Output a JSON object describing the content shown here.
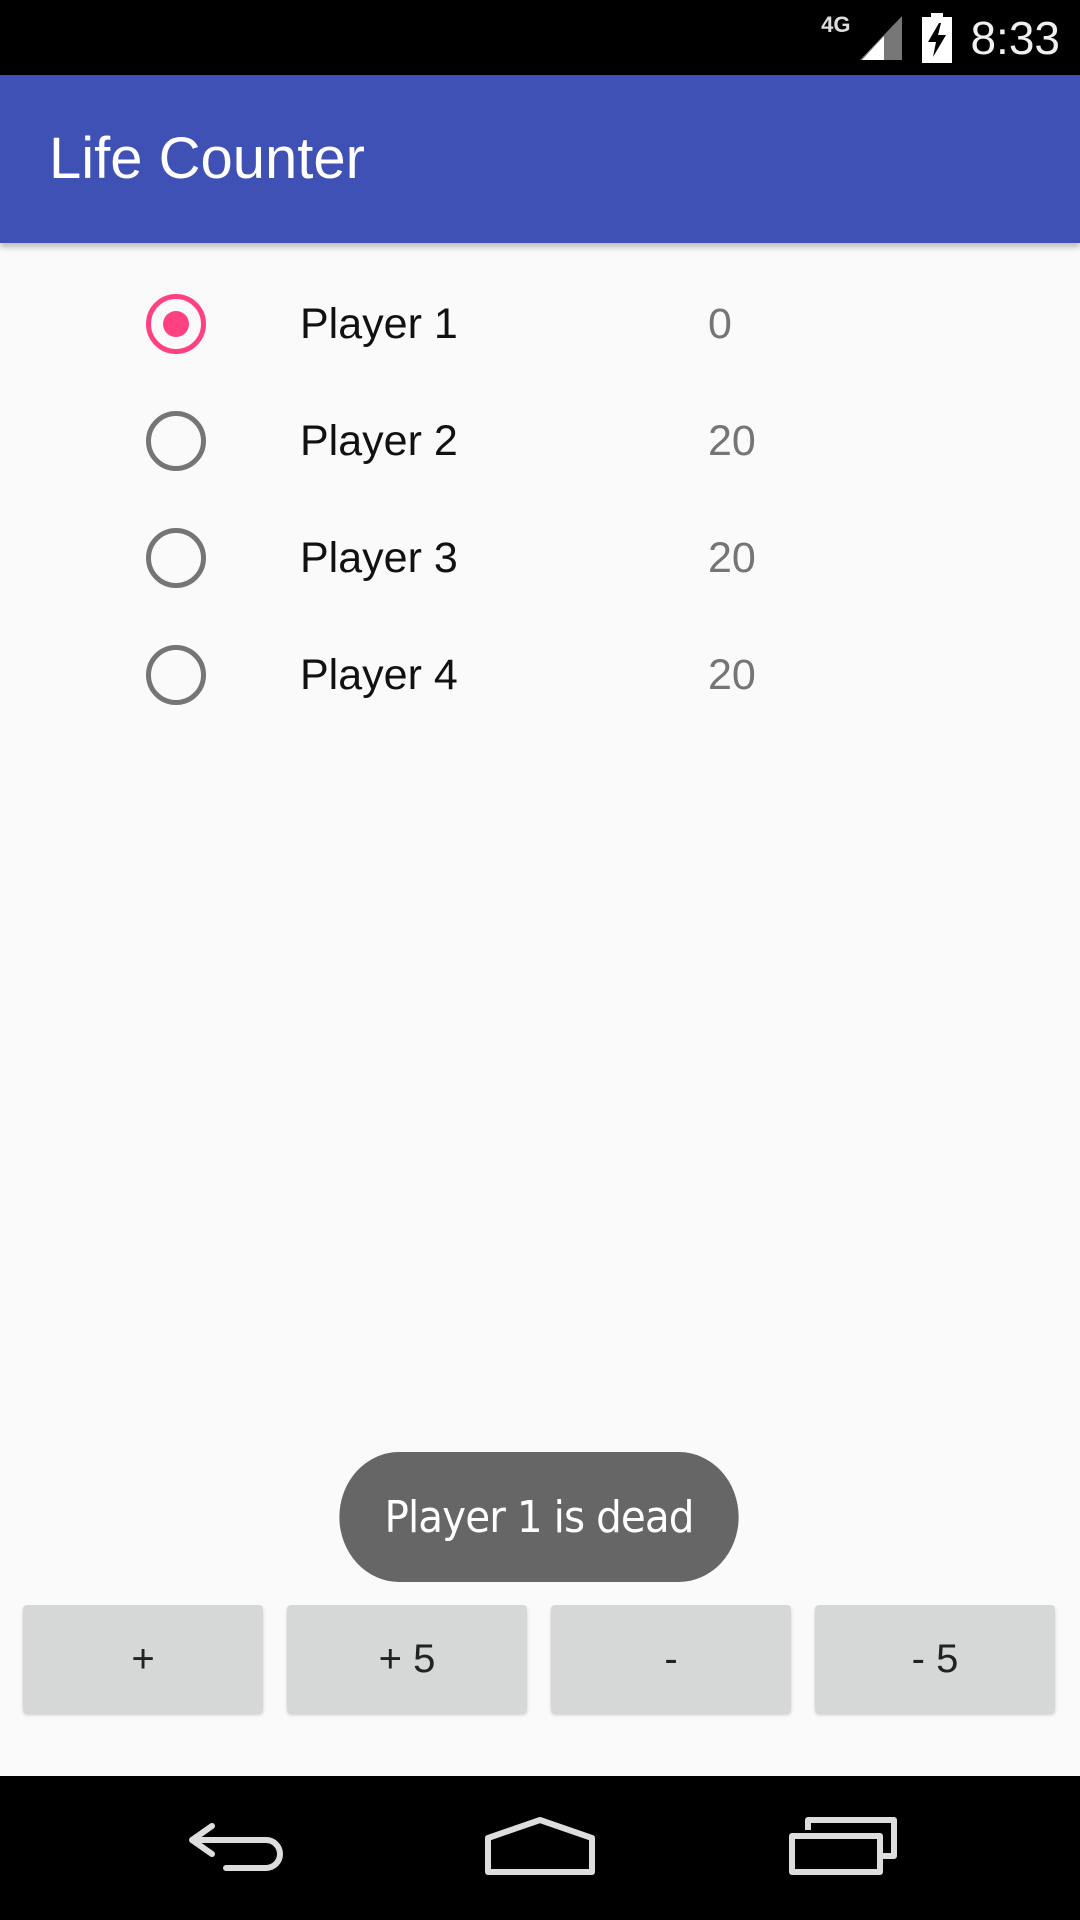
{
  "status_bar": {
    "network": "4G",
    "time": "8:33",
    "icons": [
      "signal-icon",
      "battery-charging-icon"
    ]
  },
  "app_bar": {
    "title": "Life Counter",
    "color": "#3f51b5"
  },
  "players": [
    {
      "name": "Player 1",
      "life": "0",
      "selected": true
    },
    {
      "name": "Player 2",
      "life": "20",
      "selected": false
    },
    {
      "name": "Player 3",
      "life": "20",
      "selected": false
    },
    {
      "name": "Player 4",
      "life": "20",
      "selected": false
    }
  ],
  "toast": {
    "message": "Player 1 is dead"
  },
  "buttons": {
    "plus_one": "+",
    "plus_five": "+ 5",
    "minus_one": "-",
    "minus_five": "- 5"
  },
  "nav_bar": {
    "icons": [
      "back-icon",
      "home-icon",
      "recents-icon"
    ]
  },
  "colors": {
    "accent": "#ff4081",
    "primary": "#3f51b5",
    "toast": "#666666",
    "button": "#d6d7d7"
  }
}
